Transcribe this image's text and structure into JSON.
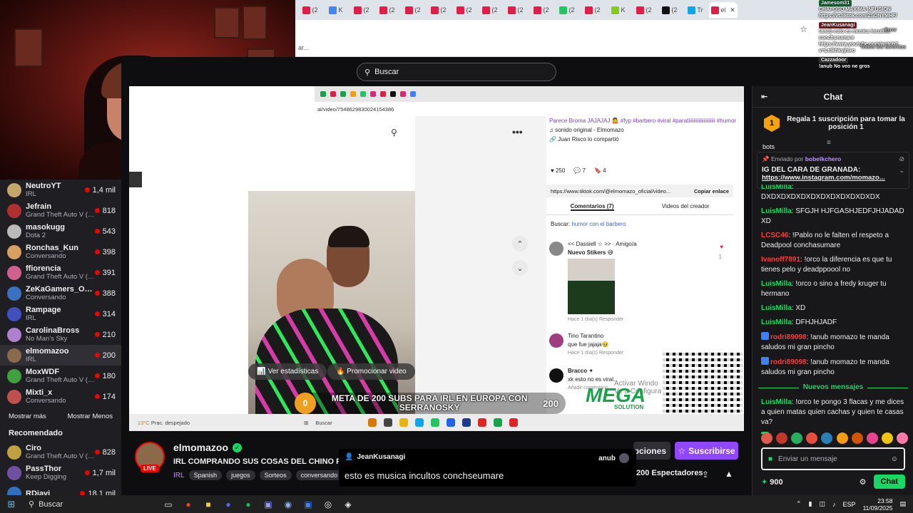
{
  "browser": {
    "tab_labels": [
      "(2",
      "K",
      "(2",
      "(2",
      "(2",
      "(2",
      "(2",
      "(2",
      "(2",
      "(2",
      "(2",
      "(2",
      "K",
      "(2",
      "(2",
      "Tr",
      "el"
    ],
    "active_tab_close": "✕",
    "bookmarks_text": "ar..."
  },
  "page": {
    "search_placeholder": "Buscar"
  },
  "sidebar": {
    "channels": [
      {
        "name": "NeutroYT",
        "category": "IRL",
        "viewers": "1,4 mil",
        "color": "#c4a56a"
      },
      {
        "name": "Jefrain",
        "category": "Grand Theft Auto V (G...",
        "viewers": "818",
        "color": "#b03030"
      },
      {
        "name": "masokugg",
        "category": "Dota 2",
        "viewers": "543",
        "color": "#bbbbbb"
      },
      {
        "name": "Ronchas_Kun",
        "category": "Conversando",
        "viewers": "398",
        "color": "#d8a060"
      },
      {
        "name": "ffiorencia",
        "category": "Grand Theft Auto V (G...",
        "viewers": "391",
        "color": "#d06090"
      },
      {
        "name": "ZeKaGamers_Oficial",
        "category": "Conversando",
        "viewers": "388",
        "color": "#3a70c0"
      },
      {
        "name": "Rampage",
        "category": "IRL",
        "viewers": "314",
        "color": "#4050c0"
      },
      {
        "name": "CarolinaBross",
        "category": "No Man's Sky",
        "viewers": "210",
        "color": "#b080d0"
      },
      {
        "name": "elmomazoo",
        "category": "IRL",
        "viewers": "200",
        "color": "#8a6a4a",
        "selected": true
      },
      {
        "name": "MoxWDF",
        "category": "Grand Theft Auto V (G...",
        "viewers": "180",
        "color": "#40a040"
      },
      {
        "name": "Mixti_x",
        "category": "Conversando",
        "viewers": "174",
        "color": "#c05050"
      }
    ],
    "show_more": "Mostrar más",
    "show_less": "Mostrar Menos",
    "recommended_title": "Recomendado",
    "recommended": [
      {
        "name": "Ciro",
        "category": "Grand Theft Auto V (G...",
        "viewers": "828",
        "color": "#c0a040"
      },
      {
        "name": "PassThor",
        "category": "Keep Digging",
        "viewers": "1,7 mil",
        "color": "#7050a0"
      },
      {
        "name": "RDjavi",
        "category": "",
        "viewers": "18,1 mil",
        "color": "#3070c0"
      }
    ]
  },
  "video": {
    "url": "al/video/754862983002415438​6",
    "side_overlay_text": [
      "rtas",
      "que"
    ],
    "description": "Parece Broma JAJAJAJ 🤷 #fyp #barbero #viral #paratiiiiiiiiiiiiiiiiiiiii #humor",
    "sound": "♫ sonido original - Elmomazo",
    "shared_by": "🔗 Juan Risco lo compartió",
    "likes": "250",
    "comments_count": "7",
    "saves": "4",
    "tiktok_url": "https://www.tiktok.com/@elmomazo_oficial/video...",
    "copy_link": "Copiar enlace",
    "tab_comments": "Comentarios (7)",
    "tab_creator": "Videos del creador",
    "search_label": "Buscar:",
    "search_link": "humor con el barbero",
    "comment1_user": "<< Dassiell ☆ >> · Amigo/a",
    "comment1_text": "Nuevo Stikers 😅",
    "comment1_meta": "Hace 1 día(s)    Responder",
    "comment1_likes": "1",
    "comment2_user": "Tino Tarantino",
    "comment2_text": "que fue jajaja🥹",
    "comment2_meta": "Hace 1 día(s)    Responder",
    "comment3_user": "Bracco ✦",
    "comment3_text": "xk esto no es viral..",
    "comment_more": "Añadir comentario...",
    "btn_stats": "📊 Ver estadísticas",
    "btn_promote": "🔥 Promocionar video",
    "goal_start": "0",
    "goal_text": "META DE 200 SUBS PARA IRL EN EUROPA CON SERRANOSKY",
    "goal_end": "200",
    "activate_windows": "Activar Windo",
    "activate_windows_sub": "Ve a Configuración",
    "mega_logo": "MEGA",
    "mega_sub": "SOLUTION",
    "weather_temp": "13°C",
    "weather_desc": "Prac. despejado",
    "taskbar_search": "Buscar"
  },
  "stream": {
    "channel": "elmomazoo",
    "live": "LIVE",
    "title": "IRL COMPRANDO SUS COSAS DEL CHINO PORQUE",
    "category": "IRL",
    "tags": [
      "Spanish",
      "juegos",
      "Sorteos",
      "conversando",
      "D"
    ],
    "subscribe": "Suscribirse",
    "options": "pciones",
    "viewers": "200 Espectadores"
  },
  "popup": {
    "user": "JeanKusanagi",
    "right_user": "anub",
    "message": "esto es musica incultos conchseumare"
  },
  "chat": {
    "title": "Chat",
    "gift_num": "1",
    "gift_text": "Regala 1 suscripción para tomar la posición 1",
    "top_fragment": "bots",
    "pinned_by_label": "Enviado por",
    "pinned_by_user": "bobelkchero",
    "pinned_text1": "IG DEL CARA DE GRANADA:",
    "pinned_text2": "https://www.instagram.com/momazo...",
    "messages": [
      {
        "user": "LuisMilla",
        "color": "#19d765",
        "text": "DXDXDXDXDXDXDXDXDXDXDXDX"
      },
      {
        "user": "LuisMilla",
        "color": "#19d765",
        "text": "SFGJH HJFGASHJEDFJHJADAD XD"
      },
      {
        "user": "LCSC46",
        "color": "#ff3a3a",
        "text": "!Pablo no le falten el respeto a Deadpool conchasumare"
      },
      {
        "user": "Ivanoff7891",
        "color": "#ff3a3a",
        "text": "!orco la diferencia es que tu tienes pelo y deadppoool no"
      },
      {
        "user": "LuisMilla",
        "color": "#19d765",
        "text": "!orco o sino a fredy kruger tu hermano"
      },
      {
        "user": "LuisMilla",
        "color": "#19d765",
        "text": "XD"
      },
      {
        "user": "LuisMilla",
        "color": "#19d765",
        "text": "DFHJHJADF"
      },
      {
        "user": "rodri89098",
        "color": "#ff3a3a",
        "text": "!anub momazo te manda saludos mi gran pincho"
      },
      {
        "user": "rodri89098",
        "color": "#ff3a3a",
        "text": "!anub momazo te manda saludos mi gran pincho"
      }
    ],
    "new_messages": "Nuevos mensajes",
    "messages_after": [
      {
        "user": "LuisMilla",
        "color": "#19d765",
        "text": "!orco te pongo 3 flacas y me dices a quien matas quien cachas y quien te casas va?"
      },
      {
        "user": "iOwen",
        "color": "#19d765",
        "text": "OE SUBE A MI CUARTO ALTOQUE GOGOOGOG"
      }
    ],
    "input_placeholder": "Enviar un mensaje",
    "points": "900",
    "chat_button": "Chat"
  },
  "tiktok_overlay": {
    "lines": [
      "Jamesom31",
      "CHAPOSO MAXIMA INFUSION",
      "https://vt.tiktok.com/ZSDNYMHF/",
      "JeanKusanagi",
      "Error",
      "!anub esto es musica incultos",
      "conchseumare",
      "Todos los favoritos",
      "https://www.youtube.com/watch?",
      "v=Ltdkhkvjhwo",
      "Cazzadoor",
      "!anub No veo ne gros"
    ]
  },
  "taskbar": {
    "search": "Buscar",
    "lang": "ESP",
    "time": "23:58",
    "date": "11/09/2025"
  }
}
